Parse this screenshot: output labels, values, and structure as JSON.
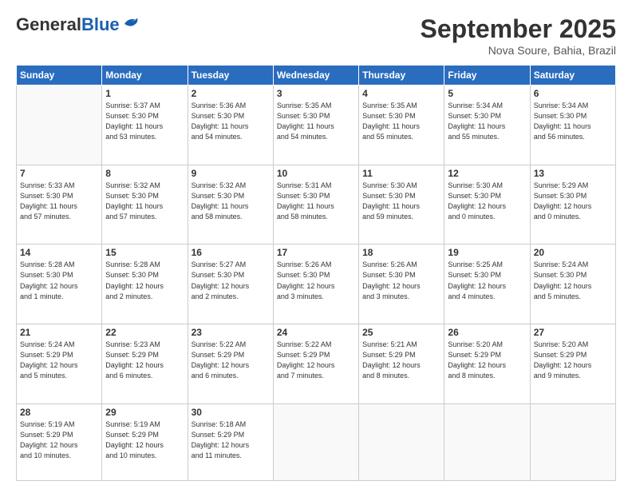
{
  "header": {
    "logo_general": "General",
    "logo_blue": "Blue",
    "title": "September 2025",
    "location": "Nova Soure, Bahia, Brazil"
  },
  "days_of_week": [
    "Sunday",
    "Monday",
    "Tuesday",
    "Wednesday",
    "Thursday",
    "Friday",
    "Saturday"
  ],
  "weeks": [
    [
      {
        "day": "",
        "info": ""
      },
      {
        "day": "1",
        "info": "Sunrise: 5:37 AM\nSunset: 5:30 PM\nDaylight: 11 hours\nand 53 minutes."
      },
      {
        "day": "2",
        "info": "Sunrise: 5:36 AM\nSunset: 5:30 PM\nDaylight: 11 hours\nand 54 minutes."
      },
      {
        "day": "3",
        "info": "Sunrise: 5:35 AM\nSunset: 5:30 PM\nDaylight: 11 hours\nand 54 minutes."
      },
      {
        "day": "4",
        "info": "Sunrise: 5:35 AM\nSunset: 5:30 PM\nDaylight: 11 hours\nand 55 minutes."
      },
      {
        "day": "5",
        "info": "Sunrise: 5:34 AM\nSunset: 5:30 PM\nDaylight: 11 hours\nand 55 minutes."
      },
      {
        "day": "6",
        "info": "Sunrise: 5:34 AM\nSunset: 5:30 PM\nDaylight: 11 hours\nand 56 minutes."
      }
    ],
    [
      {
        "day": "7",
        "info": "Sunrise: 5:33 AM\nSunset: 5:30 PM\nDaylight: 11 hours\nand 57 minutes."
      },
      {
        "day": "8",
        "info": "Sunrise: 5:32 AM\nSunset: 5:30 PM\nDaylight: 11 hours\nand 57 minutes."
      },
      {
        "day": "9",
        "info": "Sunrise: 5:32 AM\nSunset: 5:30 PM\nDaylight: 11 hours\nand 58 minutes."
      },
      {
        "day": "10",
        "info": "Sunrise: 5:31 AM\nSunset: 5:30 PM\nDaylight: 11 hours\nand 58 minutes."
      },
      {
        "day": "11",
        "info": "Sunrise: 5:30 AM\nSunset: 5:30 PM\nDaylight: 11 hours\nand 59 minutes."
      },
      {
        "day": "12",
        "info": "Sunrise: 5:30 AM\nSunset: 5:30 PM\nDaylight: 12 hours\nand 0 minutes."
      },
      {
        "day": "13",
        "info": "Sunrise: 5:29 AM\nSunset: 5:30 PM\nDaylight: 12 hours\nand 0 minutes."
      }
    ],
    [
      {
        "day": "14",
        "info": "Sunrise: 5:28 AM\nSunset: 5:30 PM\nDaylight: 12 hours\nand 1 minute."
      },
      {
        "day": "15",
        "info": "Sunrise: 5:28 AM\nSunset: 5:30 PM\nDaylight: 12 hours\nand 2 minutes."
      },
      {
        "day": "16",
        "info": "Sunrise: 5:27 AM\nSunset: 5:30 PM\nDaylight: 12 hours\nand 2 minutes."
      },
      {
        "day": "17",
        "info": "Sunrise: 5:26 AM\nSunset: 5:30 PM\nDaylight: 12 hours\nand 3 minutes."
      },
      {
        "day": "18",
        "info": "Sunrise: 5:26 AM\nSunset: 5:30 PM\nDaylight: 12 hours\nand 3 minutes."
      },
      {
        "day": "19",
        "info": "Sunrise: 5:25 AM\nSunset: 5:30 PM\nDaylight: 12 hours\nand 4 minutes."
      },
      {
        "day": "20",
        "info": "Sunrise: 5:24 AM\nSunset: 5:30 PM\nDaylight: 12 hours\nand 5 minutes."
      }
    ],
    [
      {
        "day": "21",
        "info": "Sunrise: 5:24 AM\nSunset: 5:29 PM\nDaylight: 12 hours\nand 5 minutes."
      },
      {
        "day": "22",
        "info": "Sunrise: 5:23 AM\nSunset: 5:29 PM\nDaylight: 12 hours\nand 6 minutes."
      },
      {
        "day": "23",
        "info": "Sunrise: 5:22 AM\nSunset: 5:29 PM\nDaylight: 12 hours\nand 6 minutes."
      },
      {
        "day": "24",
        "info": "Sunrise: 5:22 AM\nSunset: 5:29 PM\nDaylight: 12 hours\nand 7 minutes."
      },
      {
        "day": "25",
        "info": "Sunrise: 5:21 AM\nSunset: 5:29 PM\nDaylight: 12 hours\nand 8 minutes."
      },
      {
        "day": "26",
        "info": "Sunrise: 5:20 AM\nSunset: 5:29 PM\nDaylight: 12 hours\nand 8 minutes."
      },
      {
        "day": "27",
        "info": "Sunrise: 5:20 AM\nSunset: 5:29 PM\nDaylight: 12 hours\nand 9 minutes."
      }
    ],
    [
      {
        "day": "28",
        "info": "Sunrise: 5:19 AM\nSunset: 5:29 PM\nDaylight: 12 hours\nand 10 minutes."
      },
      {
        "day": "29",
        "info": "Sunrise: 5:19 AM\nSunset: 5:29 PM\nDaylight: 12 hours\nand 10 minutes."
      },
      {
        "day": "30",
        "info": "Sunrise: 5:18 AM\nSunset: 5:29 PM\nDaylight: 12 hours\nand 11 minutes."
      },
      {
        "day": "",
        "info": ""
      },
      {
        "day": "",
        "info": ""
      },
      {
        "day": "",
        "info": ""
      },
      {
        "day": "",
        "info": ""
      }
    ]
  ]
}
